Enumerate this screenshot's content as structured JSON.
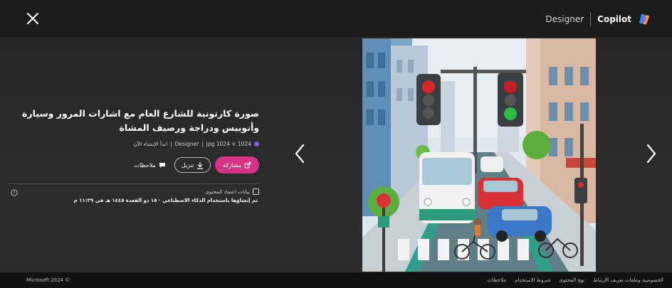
{
  "header": {
    "designer_label": "Designer",
    "copilot_label": "Copilot"
  },
  "image_info": {
    "title": "صورة كارتونية للشارع العام مع اشارات المرور وسيارة وأتوبيس ودراجة ورصيف المشاة",
    "size": "1024 × 1024 jpg",
    "source": "Designer",
    "tagline": "ابدأ الإنشاء الآن"
  },
  "actions": {
    "share_label": "مشاركة",
    "download_label": "تنزيل",
    "feedback_label": "ملاحظات"
  },
  "credentials": {
    "label": "بيانات اعتماد المحتوى",
    "detail": "تم إنشاؤها باستخدام الذكاء الاصطناعي · ١٥ ذو القعدة ١٤٤٥ هـ في ١١:٣٩ م"
  },
  "footer": {
    "copyright": "Microsoft 2024 ©",
    "links": [
      "الخصوصية وملفات تعريف الارتباط",
      "نهج المحتوى",
      "شروط الاستخدام",
      "ملاحظات"
    ]
  },
  "icons": {
    "close": "close-icon",
    "copilot": "copilot-logo-icon",
    "share": "share-icon",
    "download": "download-icon",
    "feedback": "feedback-icon",
    "credentials": "content-credentials-icon",
    "help": "help-icon",
    "prev": "chevron-left-icon",
    "next": "chevron-right-icon"
  },
  "colors": {
    "accent": "#d63384",
    "background": "#1b1b1b",
    "footer": "#121212"
  }
}
